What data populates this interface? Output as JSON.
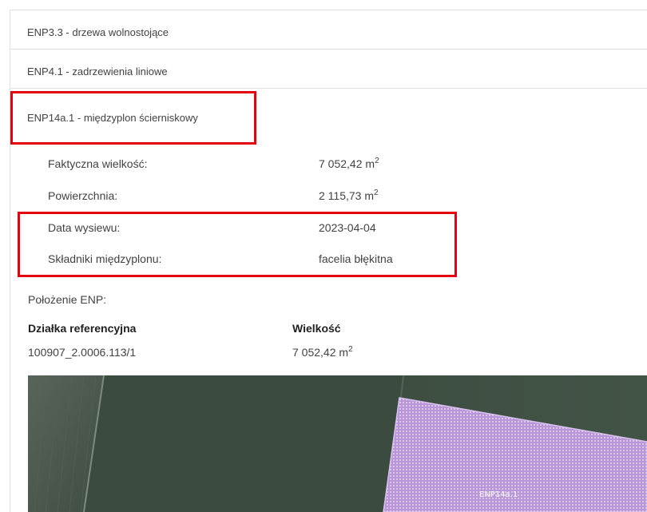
{
  "list": {
    "items": [
      {
        "label": "ENP3.3 - drzewa wolnostojące"
      },
      {
        "label": "ENP4.1 - zadrzewienia liniowe"
      },
      {
        "label": "ENP14a.1 - międzyplon ścierniskowy"
      }
    ]
  },
  "details": {
    "rows": [
      {
        "label": "Faktyczna wielkość:",
        "value": "7 052,42 m",
        "unit_sup": "2"
      },
      {
        "label": "Powierzchnia:",
        "value": "2 115,73 m",
        "unit_sup": "2"
      },
      {
        "label": "Data wysiewu:",
        "value": "2023-04-04"
      },
      {
        "label": "Składniki międzyplonu:",
        "value": "facelia błękitna"
      }
    ]
  },
  "location": {
    "title": "Położenie ENP:",
    "headers": {
      "parcel": "Działka referencyjna",
      "size": "Wielkość"
    },
    "rows": [
      {
        "parcel": "100907_2.0006.113/1",
        "size": "7 052,42 m",
        "size_sup": "2"
      }
    ]
  },
  "map": {
    "label": "ENP14a.1",
    "polygon_color": "#c8a0e6",
    "field_color": "#3d4c41"
  },
  "colors": {
    "highlight": "#e3000f",
    "border": "#e0e0e0",
    "text": "#424242"
  }
}
